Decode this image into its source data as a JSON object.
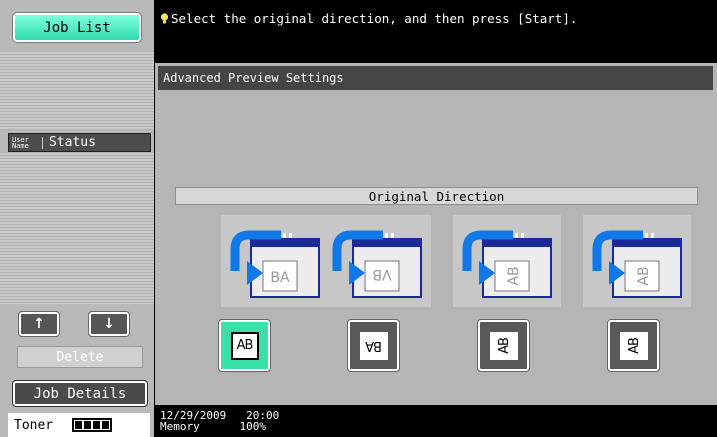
{
  "sidebar": {
    "job_list_label": "Job List",
    "col_user_line1": "User",
    "col_user_line2": "Name",
    "col_status": "Status",
    "up_glyph": "↑",
    "down_glyph": "↓",
    "delete_label": "Delete",
    "job_details_label": "Job Details",
    "toner_label": "Toner",
    "toner_level": 1.0
  },
  "message": {
    "text": "Select the original direction, and then press [Start]."
  },
  "panel": {
    "title": "Advanced Preview Settings",
    "section_title": "Original Direction",
    "options": [
      {
        "icon_text": "BA",
        "button_text": "AB",
        "selected": true,
        "icon": "orientation-icon"
      },
      {
        "icon_text": "VB",
        "button_text": "BA",
        "selected": false,
        "icon": "orientation-icon"
      },
      {
        "icon_text": "AB",
        "button_text": "AB",
        "selected": false,
        "icon": "orientation-icon"
      },
      {
        "icon_text": "AB",
        "button_text": "AB",
        "selected": false,
        "icon": "orientation-icon"
      }
    ]
  },
  "status_bar": {
    "date": "12/29/2009",
    "time": "20:00",
    "memory_label": "Memory",
    "memory_value": "100%"
  },
  "colors": {
    "accent": "#3ae0a8",
    "panel_bg": "#b5b5b5",
    "titlebar": "#454545"
  }
}
